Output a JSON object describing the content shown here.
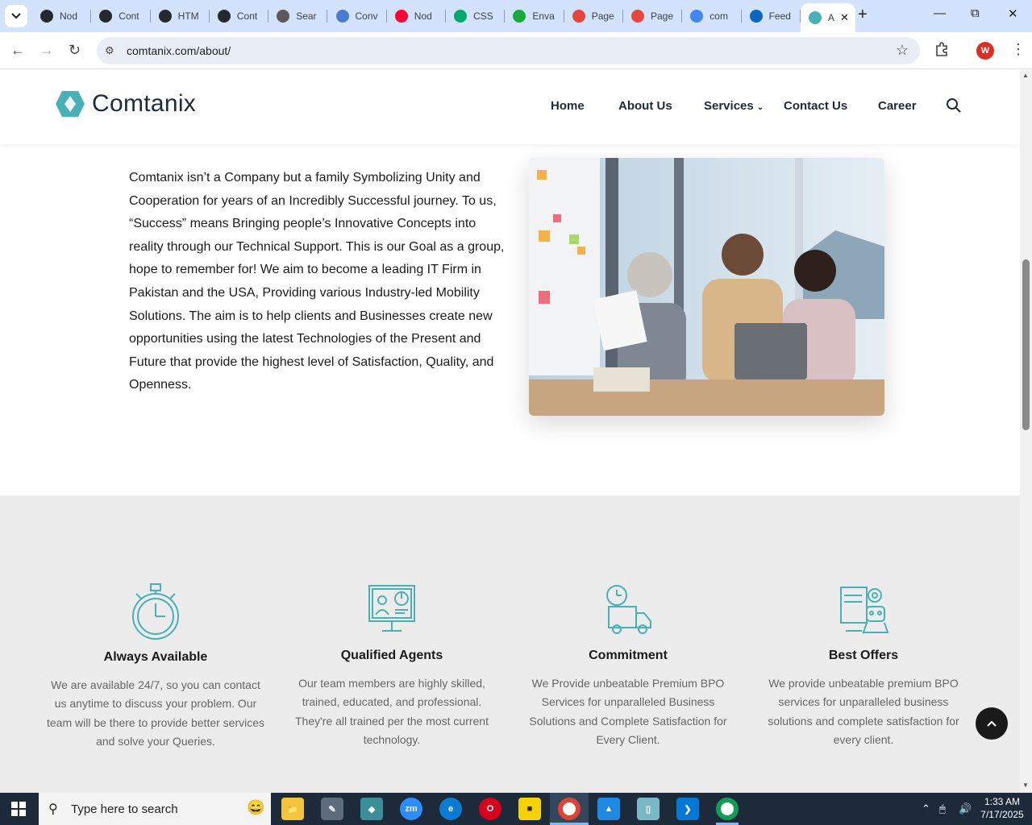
{
  "browser": {
    "tabs": [
      {
        "label": "Nod",
        "favicon": "github-icon",
        "color": "#24292f"
      },
      {
        "label": "Cont",
        "favicon": "github-icon",
        "color": "#24292f"
      },
      {
        "label": "HTM",
        "favicon": "github-icon",
        "color": "#24292f"
      },
      {
        "label": "Cont",
        "favicon": "github-icon",
        "color": "#24292f"
      },
      {
        "label": "Sear",
        "favicon": "wordpress-icon",
        "color": "#5a5a5a"
      },
      {
        "label": "Conv",
        "favicon": "convertio-icon",
        "color": "#4a7bd0"
      },
      {
        "label": "Nod",
        "favicon": "youtube-icon",
        "color": "#ff0033"
      },
      {
        "label": "CSS",
        "favicon": "w3schools-icon",
        "color": "#04aa6d"
      },
      {
        "label": "Enva",
        "favicon": "envato-icon",
        "color": "#1ba83c"
      },
      {
        "label": "Page",
        "favicon": "pagespeed-icon",
        "color": "#e8453c"
      },
      {
        "label": "Page",
        "favicon": "pagespeed-icon",
        "color": "#e8453c"
      },
      {
        "label": "com",
        "favicon": "google-icon",
        "color": "#4285f4"
      },
      {
        "label": "Feed",
        "favicon": "linkedin-icon",
        "color": "#0a66c2"
      },
      {
        "label": "A",
        "favicon": "comtanix-icon",
        "color": "#4ab0b8"
      }
    ],
    "url": "comtanix.com/about/"
  },
  "site": {
    "logo_text": "Comtanix",
    "brand_color": "#4ab0b8",
    "nav": [
      "Home",
      "About Us",
      "Services",
      "Contact Us",
      "Career"
    ]
  },
  "about": {
    "paragraph": "Comtanix isn’t a Company but a family Symbolizing Unity and Cooperation for years of an Incredibly Successful journey. To us, “Success” means Bringing people’s Innovative Concepts into reality through our Technical Support. This is our Goal as a group, hope to remember for! We aim to become a leading IT Firm in Pakistan and the USA, Providing various Industry-led Mobility Solutions. The aim is to help clients and Businesses create new opportunities using the latest Technologies of the Present and Future that provide the highest level of Satisfaction, Quality, and Openness."
  },
  "features": [
    {
      "title": "Always Available",
      "icon": "stopwatch-icon",
      "text": "We are available 24/7, so you can contact us anytime to discuss your problem. Our team will be there to provide better services and solve your Queries."
    },
    {
      "title": "Qualified Agents",
      "icon": "presentation-agent-icon",
      "text": "Our team members are highly skilled, trained, educated, and professional. They're all trained per the most current technology."
    },
    {
      "title": "Commitment",
      "icon": "delivery-truck-clock-icon",
      "text": "We Provide unbeatable Premium BPO Services for unparalleled Business Solutions and Complete Satisfaction for Every Client."
    },
    {
      "title": "Best Offers",
      "icon": "robot-offer-icon",
      "text": "We provide unbeatable premium BPO services for unparalleled business solutions and complete satisfaction for every client."
    }
  ],
  "taskbar": {
    "search_placeholder": "Type here to search",
    "time": "1:33 AM",
    "date": "7/17/2025"
  }
}
